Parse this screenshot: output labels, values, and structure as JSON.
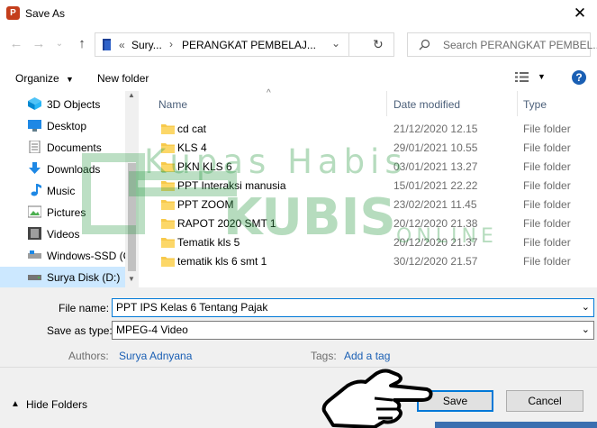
{
  "window": {
    "title": "Save As",
    "app_icon_letter": "P"
  },
  "nav": {
    "breadcrumb_overflow": "«",
    "breadcrumb": [
      "Sury...",
      "PERANGKAT PEMBELAJ..."
    ],
    "search_placeholder": "Search PERANGKAT PEMBEL..."
  },
  "toolbar": {
    "organize_label": "Organize",
    "new_folder_label": "New folder",
    "help_label": "?"
  },
  "sidebar": {
    "items": [
      {
        "label": "3D Objects",
        "icon": "cube-icon"
      },
      {
        "label": "Desktop",
        "icon": "desktop-icon"
      },
      {
        "label": "Documents",
        "icon": "document-icon"
      },
      {
        "label": "Downloads",
        "icon": "download-icon"
      },
      {
        "label": "Music",
        "icon": "music-icon"
      },
      {
        "label": "Pictures",
        "icon": "picture-icon"
      },
      {
        "label": "Videos",
        "icon": "video-icon"
      },
      {
        "label": "Windows-SSD (C",
        "icon": "drive-icon"
      },
      {
        "label": "Surya Disk (D:)",
        "icon": "drive-icon",
        "selected": true
      }
    ]
  },
  "files": {
    "columns": {
      "name": "Name",
      "date": "Date modified",
      "type": "Type"
    },
    "rows": [
      {
        "name": "cd cat",
        "date": "21/12/2020 12.15",
        "type": "File folder"
      },
      {
        "name": "KLS 4",
        "date": "29/01/2021 10.55",
        "type": "File folder"
      },
      {
        "name": "PKN KLS 6",
        "date": "03/01/2021 13.27",
        "type": "File folder"
      },
      {
        "name": "PPT Interaksi manusia",
        "date": "15/01/2021 22.22",
        "type": "File folder"
      },
      {
        "name": "PPT ZOOM",
        "date": "23/02/2021 11.45",
        "type": "File folder"
      },
      {
        "name": "RAPOT 2020 SMT 1",
        "date": "20/12/2020 21.38",
        "type": "File folder"
      },
      {
        "name": "Tematik kls 5",
        "date": "20/12/2020 21.37",
        "type": "File folder"
      },
      {
        "name": "tematik kls 6 smt 1",
        "date": "30/12/2020 21.57",
        "type": "File folder"
      }
    ]
  },
  "form": {
    "filename_label": "File name:",
    "filename_value": "PPT IPS Kelas 6 Tentang Pajak",
    "savetype_label": "Save as type:",
    "savetype_value": "MPEG-4 Video",
    "authors_label": "Authors:",
    "authors_value": "Surya Adnyana",
    "tags_label": "Tags:",
    "tags_value": "Add a tag",
    "hide_folders_label": "Hide Folders",
    "save_label": "Save",
    "cancel_label": "Cancel"
  },
  "watermark": {
    "line1": "Kupas Habis",
    "line2": "KUBIS",
    "line3": "ONLINE"
  },
  "colors": {
    "accent": "#0078d7",
    "folder": "#f7c94b",
    "link": "#1a5fb4"
  }
}
